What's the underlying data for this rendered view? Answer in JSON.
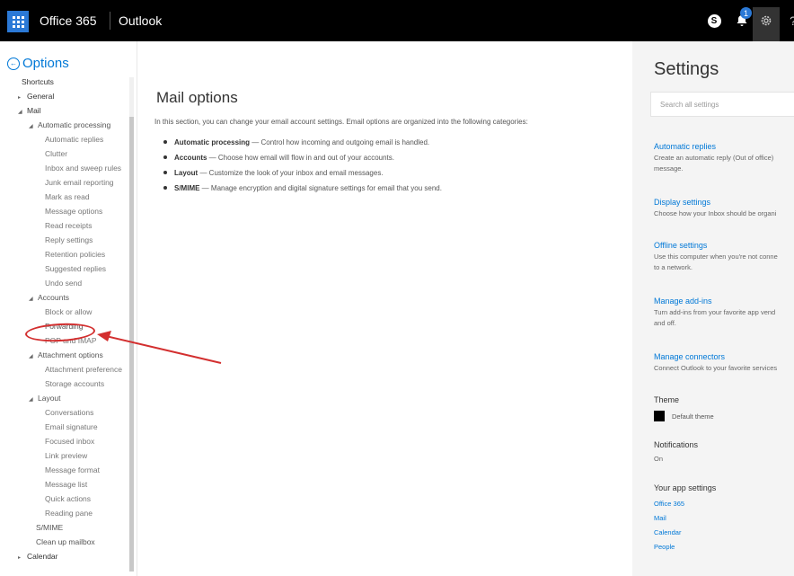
{
  "topbar": {
    "brand": "Office 365",
    "app": "Outlook",
    "skype_label": "S",
    "notification_count": "1",
    "help_label": "?"
  },
  "left": {
    "options_title": "Options",
    "nav": [
      {
        "label": "Shortcuts",
        "level": "l1",
        "caret": ""
      },
      {
        "label": "General",
        "level": "l1c",
        "caret": "▸"
      },
      {
        "label": "Mail",
        "level": "l1c",
        "caret": "◢"
      },
      {
        "label": "Automatic processing",
        "level": "l2",
        "caret": "◢"
      },
      {
        "label": "Automatic replies",
        "level": "l3",
        "caret": ""
      },
      {
        "label": "Clutter",
        "level": "l3",
        "caret": ""
      },
      {
        "label": "Inbox and sweep rules",
        "level": "l3",
        "caret": ""
      },
      {
        "label": "Junk email reporting",
        "level": "l3",
        "caret": ""
      },
      {
        "label": "Mark as read",
        "level": "l3",
        "caret": ""
      },
      {
        "label": "Message options",
        "level": "l3",
        "caret": ""
      },
      {
        "label": "Read receipts",
        "level": "l3",
        "caret": ""
      },
      {
        "label": "Reply settings",
        "level": "l3",
        "caret": ""
      },
      {
        "label": "Retention policies",
        "level": "l3",
        "caret": ""
      },
      {
        "label": "Suggested replies",
        "level": "l3",
        "caret": ""
      },
      {
        "label": "Undo send",
        "level": "l3",
        "caret": ""
      },
      {
        "label": "Accounts",
        "level": "l2",
        "caret": "◢"
      },
      {
        "label": "Block or allow",
        "level": "l3",
        "caret": ""
      },
      {
        "label": "Forwarding",
        "level": "l3",
        "caret": ""
      },
      {
        "label": "POP and IMAP",
        "level": "l3",
        "caret": ""
      },
      {
        "label": "Attachment options",
        "level": "l2",
        "caret": "◢"
      },
      {
        "label": "Attachment preference",
        "level": "l3",
        "caret": ""
      },
      {
        "label": "Storage accounts",
        "level": "l3",
        "caret": ""
      },
      {
        "label": "Layout",
        "level": "l2",
        "caret": "◢"
      },
      {
        "label": "Conversations",
        "level": "l3",
        "caret": ""
      },
      {
        "label": "Email signature",
        "level": "l3",
        "caret": ""
      },
      {
        "label": "Focused inbox",
        "level": "l3",
        "caret": ""
      },
      {
        "label": "Link preview",
        "level": "l3",
        "caret": ""
      },
      {
        "label": "Message format",
        "level": "l3",
        "caret": ""
      },
      {
        "label": "Message list",
        "level": "l3",
        "caret": ""
      },
      {
        "label": "Quick actions",
        "level": "l3",
        "caret": ""
      },
      {
        "label": "Reading pane",
        "level": "l3",
        "caret": ""
      },
      {
        "label": "S/MIME",
        "level": "l2b",
        "caret": ""
      },
      {
        "label": "Clean up mailbox",
        "level": "l2b",
        "caret": ""
      },
      {
        "label": "Calendar",
        "level": "l1c",
        "caret": "▸"
      }
    ]
  },
  "main": {
    "title": "Mail options",
    "intro": "In this section, you can change your email account settings. Email options are organized into the following categories:",
    "bullets": [
      {
        "name": "Automatic processing",
        "text": " — Control how incoming and outgoing email is handled."
      },
      {
        "name": "Accounts",
        "text": " — Choose how email will flow in and out of your accounts."
      },
      {
        "name": "Layout",
        "text": " — Customize the look of your inbox and email messages."
      },
      {
        "name": "S/MIME",
        "text": " — Manage encryption and digital signature settings for email that you send."
      }
    ]
  },
  "settings": {
    "title": "Settings",
    "search_placeholder": "Search all settings",
    "auto_replies": "Automatic replies",
    "auto_replies_desc1": "Create an automatic reply (Out of office)",
    "auto_replies_desc2": "message.",
    "display": "Display settings",
    "display_desc": "Choose how your Inbox should be organi",
    "offline": "Offline settings",
    "offline_desc1": "Use this computer when you're not conne",
    "offline_desc2": "to a network.",
    "addins": "Manage add-ins",
    "addins_desc1": "Turn add-ins from your favorite app vend",
    "addins_desc2": "and off.",
    "connectors": "Manage connectors",
    "connectors_desc": "Connect Outlook to your favorite services",
    "theme_head": "Theme",
    "theme_label": "Default theme",
    "notif_head": "Notifications",
    "notif_value": "On",
    "apps_head": "Your app settings",
    "apps": [
      "Office 365",
      "Mail",
      "Calendar",
      "People"
    ]
  },
  "colors": {
    "accent": "#0078d7",
    "topbar": "#000000",
    "annotation": "#d32f2f"
  }
}
